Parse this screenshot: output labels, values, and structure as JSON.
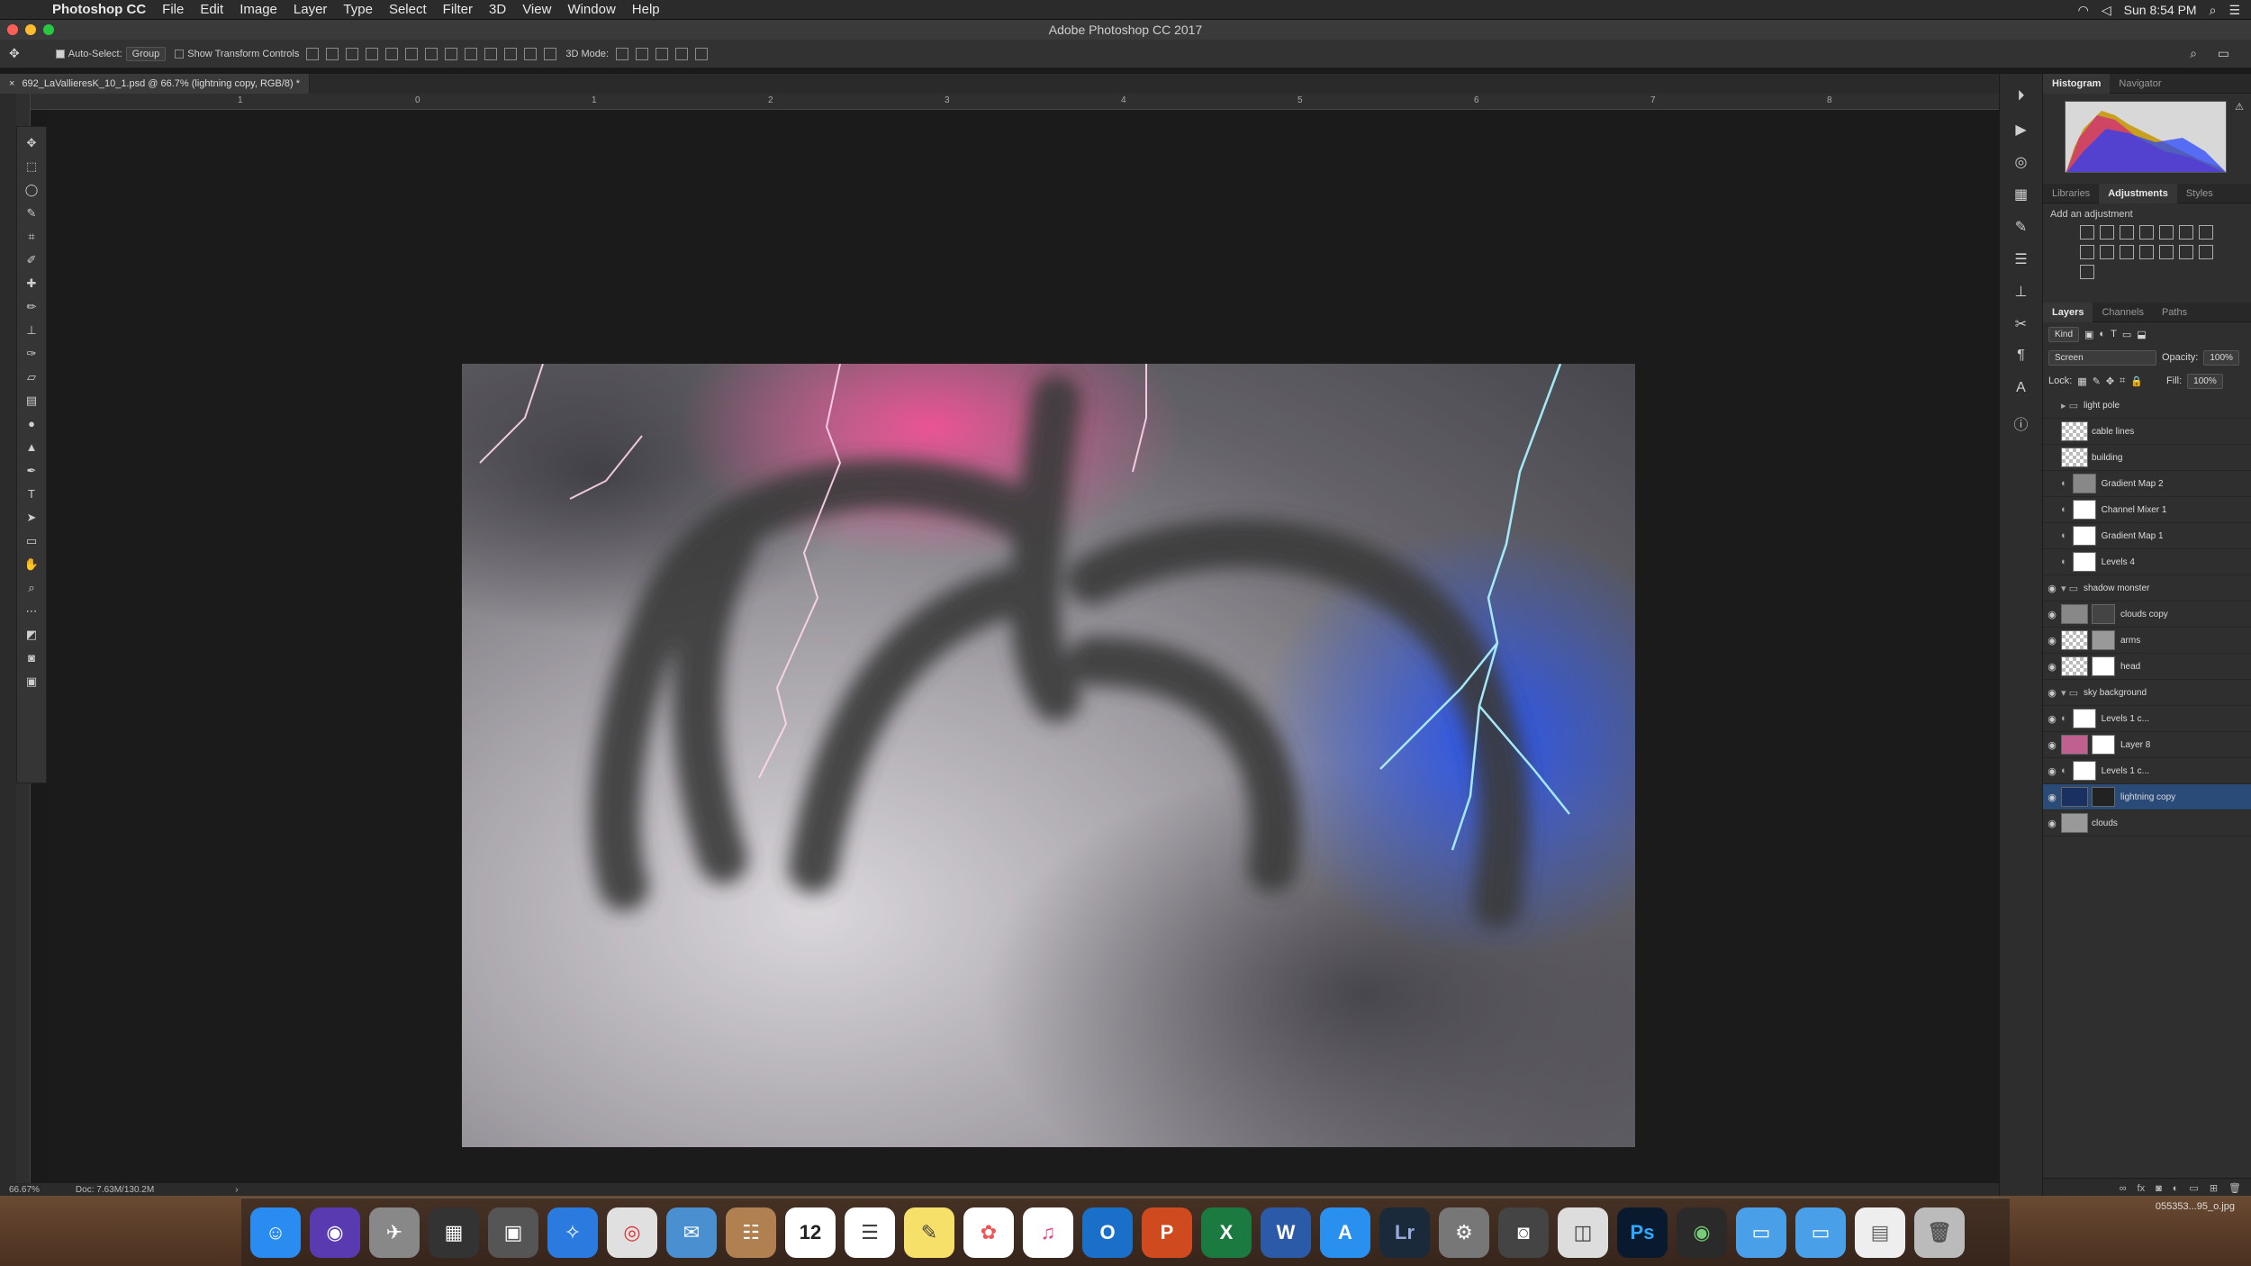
{
  "menubar": {
    "app_name": "Photoshop CC",
    "items": [
      "File",
      "Edit",
      "Image",
      "Layer",
      "Type",
      "Select",
      "Filter",
      "3D",
      "View",
      "Window",
      "Help"
    ],
    "clock": "Sun 8:54 PM"
  },
  "window": {
    "title": "Adobe Photoshop CC 2017"
  },
  "options": {
    "auto_select_label": "Auto-Select:",
    "auto_select_value": "Group",
    "transform_label": "Show Transform Controls",
    "mode_label": "3D Mode:"
  },
  "document": {
    "tab_title": "692_LaVallieresK_10_1.psd @ 66.7% (lightning copy, RGB/8) *",
    "ruler_ticks": [
      "1",
      "0",
      "1",
      "2",
      "3",
      "4",
      "5",
      "6",
      "7",
      "8"
    ]
  },
  "status": {
    "zoom": "66.67%",
    "doc": "Doc: 7.63M/130.2M"
  },
  "panels": {
    "top_tabs": [
      "Histogram",
      "Navigator"
    ],
    "adj_tabs": [
      "Libraries",
      "Adjustments",
      "Styles"
    ],
    "adj_label": "Add an adjustment",
    "layer_tabs": [
      "Layers",
      "Channels",
      "Paths"
    ],
    "kind_label": "Kind",
    "blend_mode": "Screen",
    "opacity_label": "Opacity:",
    "opacity": "100%",
    "lock_label": "Lock:",
    "fill_label": "Fill:",
    "fill": "100%"
  },
  "layers": [
    {
      "name": "light pole",
      "type": "group",
      "visible": false
    },
    {
      "name": "cable lines",
      "type": "layer",
      "visible": false
    },
    {
      "name": "building",
      "type": "layer",
      "visible": false
    },
    {
      "name": "Gradient Map 2",
      "type": "adjust",
      "visible": false
    },
    {
      "name": "Channel Mixer 1",
      "type": "adjust",
      "visible": false
    },
    {
      "name": "Gradient Map 1",
      "type": "adjust",
      "visible": false
    },
    {
      "name": "Levels 4",
      "type": "adjust",
      "visible": false
    },
    {
      "name": "shadow monster",
      "type": "group",
      "visible": true
    },
    {
      "name": "clouds copy",
      "type": "layer",
      "visible": true
    },
    {
      "name": "arms",
      "type": "layer",
      "visible": true
    },
    {
      "name": "head",
      "type": "layer",
      "visible": true
    },
    {
      "name": "sky background",
      "type": "group",
      "visible": true
    },
    {
      "name": "Levels 1 c...",
      "type": "adjust",
      "visible": true
    },
    {
      "name": "Layer 8",
      "type": "layer",
      "visible": true
    },
    {
      "name": "Levels 1 c...",
      "type": "adjust",
      "visible": true
    },
    {
      "name": "lightning copy",
      "type": "layer",
      "visible": true,
      "selected": true
    },
    {
      "name": "clouds",
      "type": "layer",
      "visible": true
    }
  ],
  "dock": {
    "icons": [
      "Finder",
      "Siri",
      "Launchpad",
      "Mission",
      "Preview",
      "Safari",
      "Chrome",
      "Mail",
      "Contacts",
      "12",
      "Reminders",
      "Notes",
      "Photos",
      "iTunes",
      "Outlook",
      "PowerPoint",
      "Excel",
      "Word",
      "App Store",
      "Lr",
      "Settings",
      "Camera",
      "Preview2",
      "Ps",
      "Monitor",
      "Folder",
      "Folder2",
      "Doc",
      "Trash"
    ],
    "corner_label": "055353...95_o.jpg"
  },
  "colors": {
    "accent": "#2a4a78",
    "ps_blue": "#31a8ff",
    "lr_blue": "#31a8ff"
  }
}
